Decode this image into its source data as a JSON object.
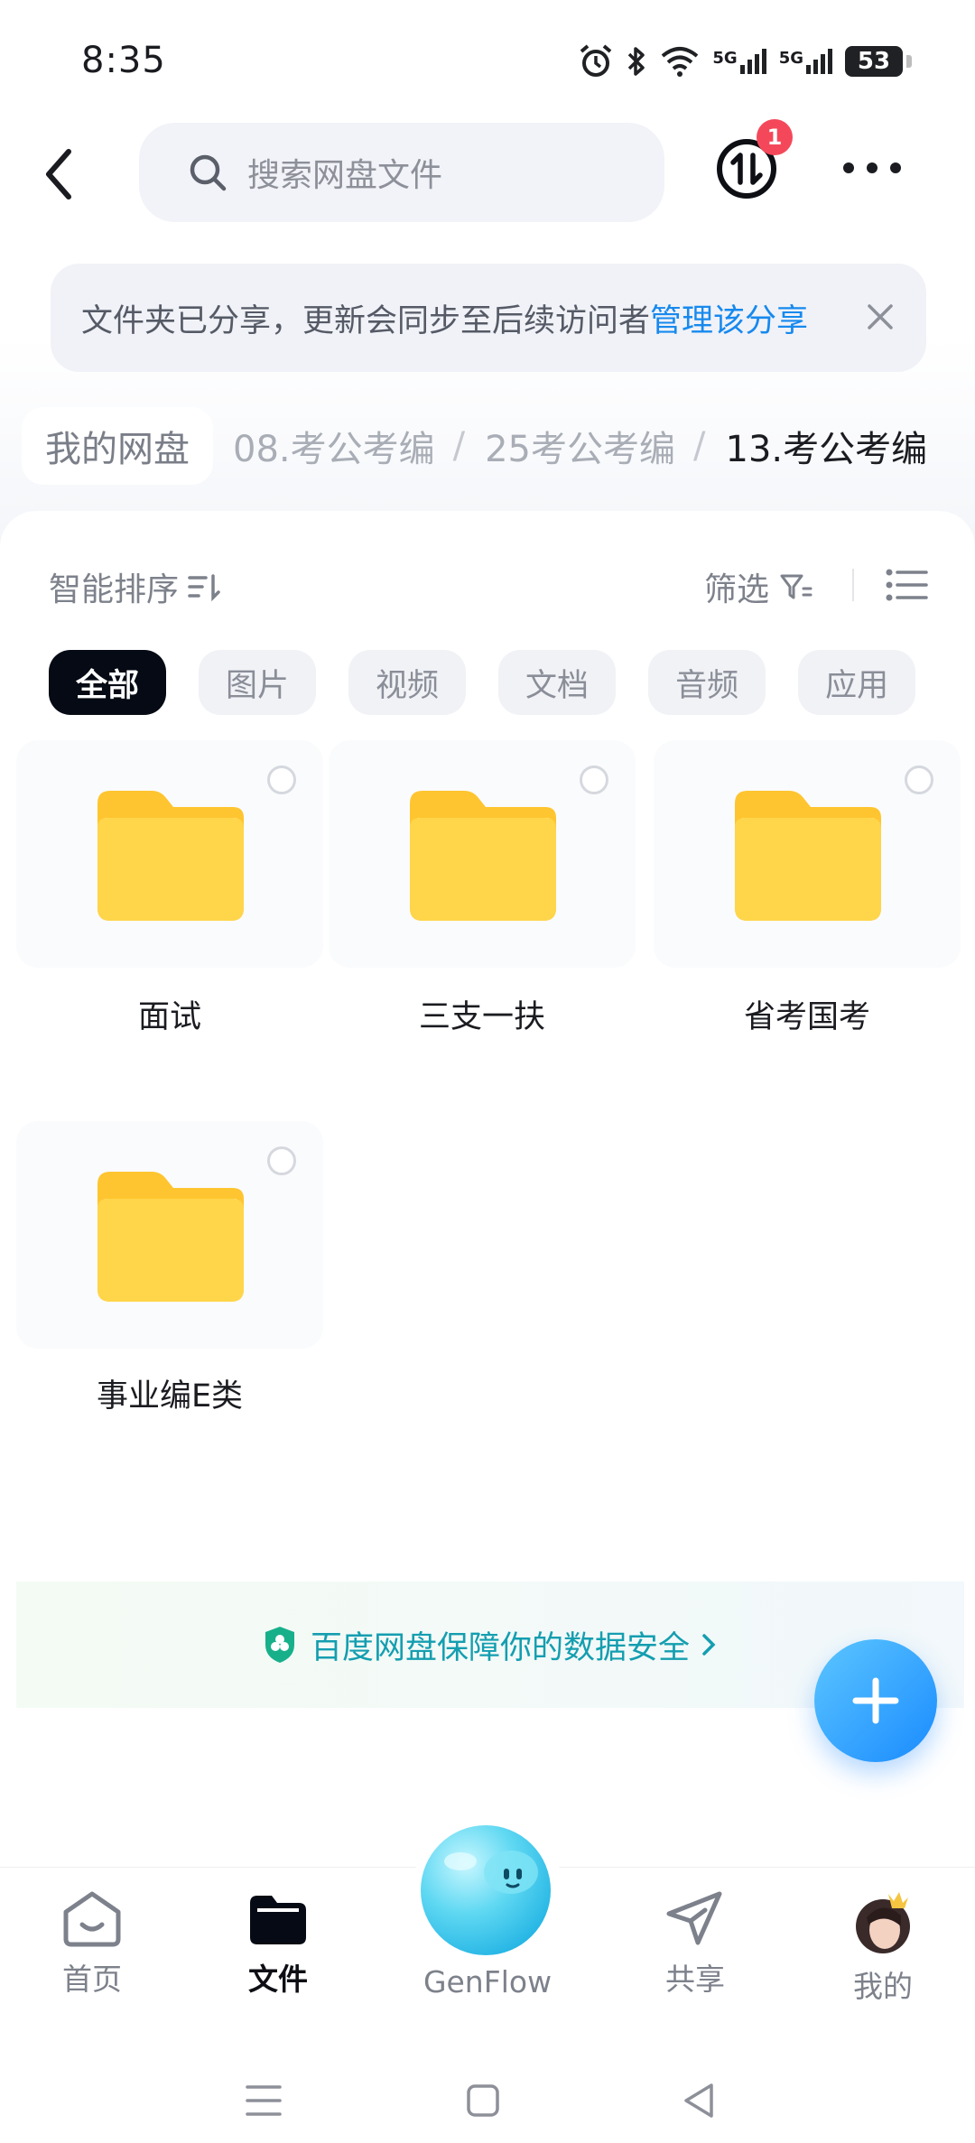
{
  "status_bar": {
    "time": "8:35",
    "network_1": "5G",
    "network_2": "5G",
    "battery": "53"
  },
  "header": {
    "search_placeholder": "搜索网盘文件",
    "transfer_badge": "1"
  },
  "notice": {
    "text": "文件夹已分享，更新会同步至后续访问者",
    "link": "管理该分享"
  },
  "breadcrumb": {
    "home": "我的网盘",
    "items": [
      "08.考公考编",
      "25考公考编"
    ],
    "current": "13.考公考编"
  },
  "toolbar": {
    "sort_label": "智能排序",
    "filter_label": "筛选"
  },
  "chips": [
    "全部",
    "图片",
    "视频",
    "文档",
    "音频",
    "应用"
  ],
  "folders": [
    {
      "name": "面试"
    },
    {
      "name": "三支一扶"
    },
    {
      "name": "省考国考"
    },
    {
      "name": "事业编E类"
    }
  ],
  "security_banner": "百度网盘保障你的数据安全",
  "tabs": {
    "home": "首页",
    "files": "文件",
    "genflow": "GenFlow",
    "share": "共享",
    "mine": "我的"
  },
  "colors": {
    "accent": "#1789ee",
    "folder": "#ffcf3f",
    "fab": "#1a8bff",
    "badge": "#f4485a"
  }
}
